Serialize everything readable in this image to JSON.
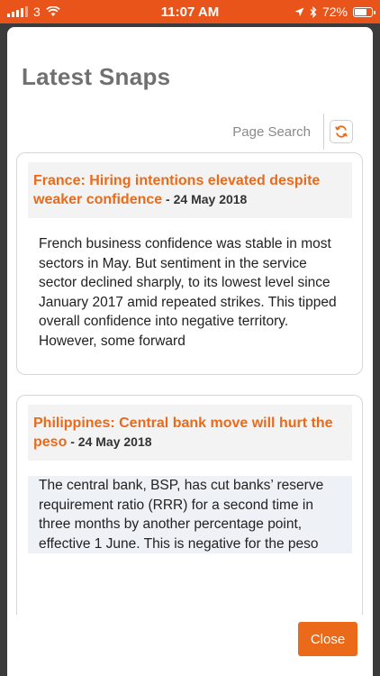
{
  "status_bar": {
    "carrier": "3",
    "time": "11:07 AM",
    "battery_percent": "72%",
    "battery_level": 0.72
  },
  "modal": {
    "title": "Latest Snaps",
    "search_label": "Page Search",
    "close_label": "Close"
  },
  "snaps": [
    {
      "title": "France: Hiring intentions elevated despite weaker confidence",
      "date": " - 24 May 2018",
      "body": "French business confidence was stable in most sectors in May. But sentiment in the service sector declined sharply, to its lowest level since January 2017 amid repeated strikes. This tipped overall confidence into negative territory. However, some forward"
    },
    {
      "title": "Philippines: Central bank move will hurt the peso",
      "date": " - 24 May 2018",
      "body": "The central bank, BSP, has cut banks’ reserve requirement ratio (RRR) for a second time in three months by another percentage point, effective 1 June. This is negative for the peso"
    }
  ],
  "colors": {
    "accent": "#ea6a1a",
    "status_bar_bg": "#e9541a",
    "title_gray": "#707070"
  }
}
